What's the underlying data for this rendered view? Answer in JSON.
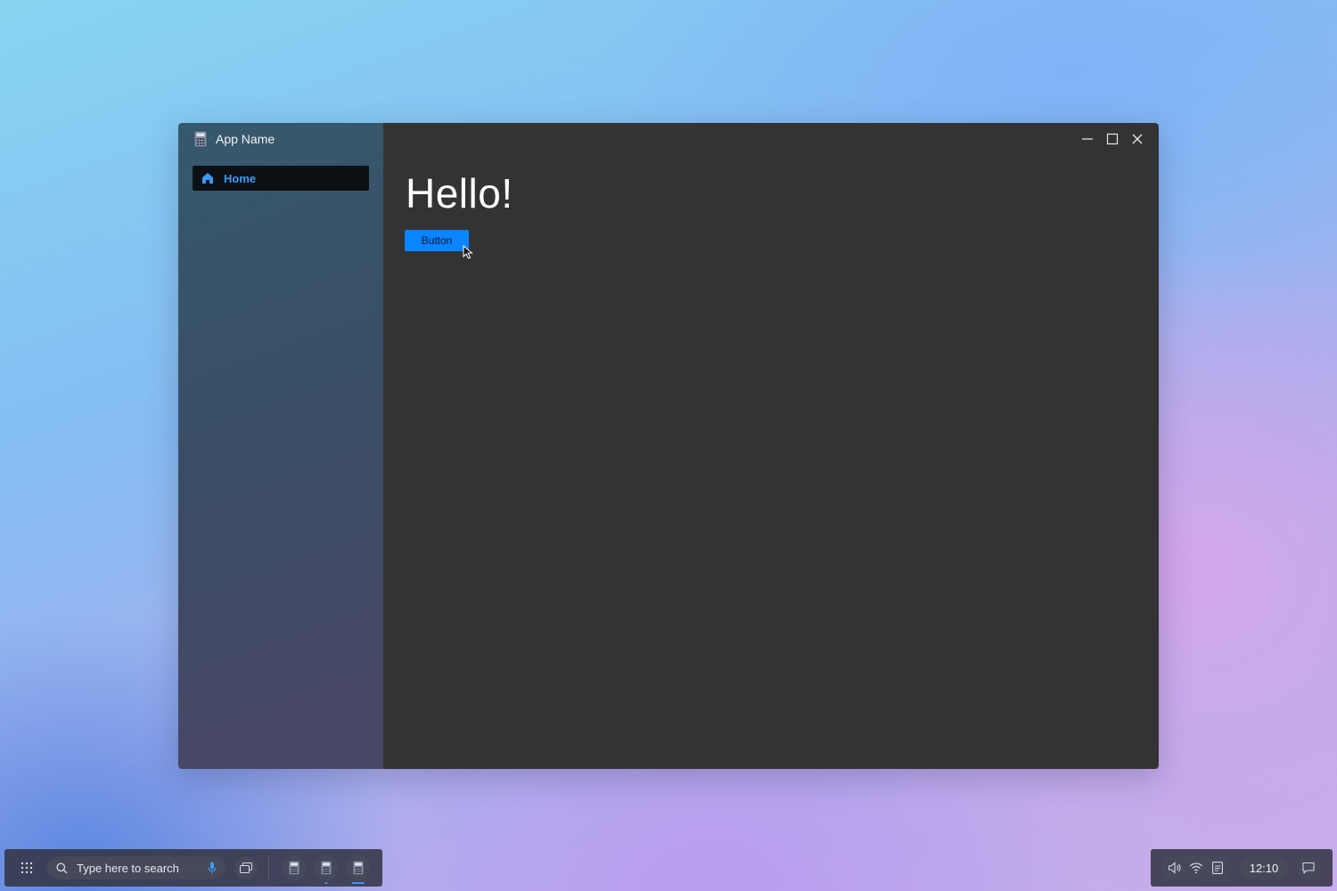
{
  "window": {
    "app_name": "App Name",
    "app_icon": "calculator-icon",
    "controls": [
      "minimize-icon",
      "maximize-icon",
      "close-icon"
    ]
  },
  "sidebar": {
    "items": [
      {
        "label": "Home",
        "icon": "home-icon",
        "selected": true
      }
    ]
  },
  "main": {
    "heading": "Hello!",
    "button_label": "Button"
  },
  "taskbar": {
    "launcher_icon": "grid-icon",
    "search_placeholder": "Type here to search",
    "pinned_apps": [
      {
        "icon": "calculator-icon",
        "indicator": "none"
      },
      {
        "icon": "calculator-icon",
        "indicator": "dot"
      },
      {
        "icon": "calculator-icon",
        "indicator": "active"
      }
    ],
    "tray": [
      "volume-icon",
      "wifi-icon",
      "clipboard-icon"
    ],
    "clock": "12:10",
    "notifications_icon": "chat-icon"
  },
  "colors": {
    "accent": "#0a84ff",
    "main_bg": "#333333",
    "nav_selected_bg": "#0d1116",
    "nav_selected_text": "#3b9af3"
  }
}
